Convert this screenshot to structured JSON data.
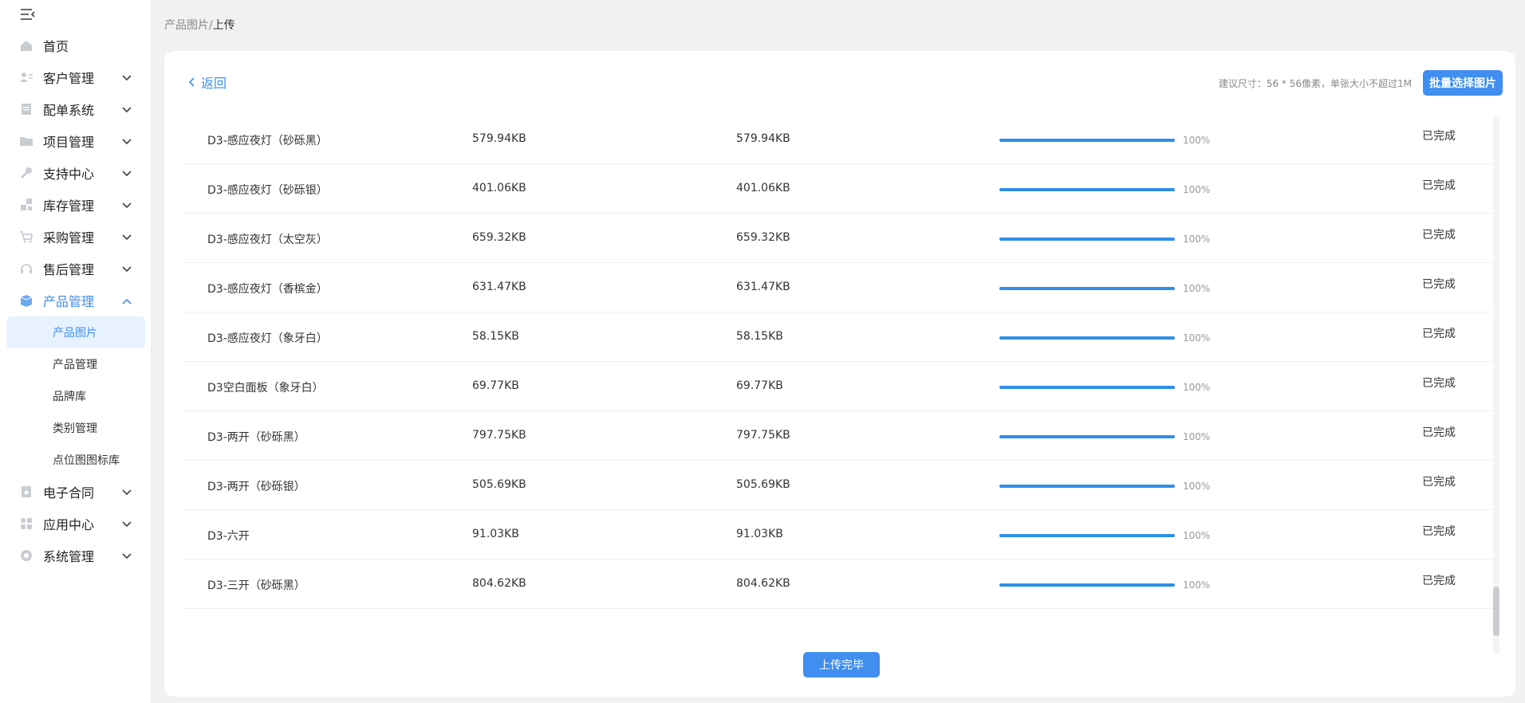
{
  "sidebar": {
    "collapse_icon": "menu-collapse-icon",
    "items": [
      {
        "label": "首页",
        "icon": "home-icon",
        "has_children": false
      },
      {
        "label": "客户管理",
        "icon": "user-card-icon",
        "has_children": true
      },
      {
        "label": "配单系统",
        "icon": "document-icon",
        "has_children": true
      },
      {
        "label": "项目管理",
        "icon": "folder-icon",
        "has_children": true
      },
      {
        "label": "支持中心",
        "icon": "wrench-icon",
        "has_children": true
      },
      {
        "label": "库存管理",
        "icon": "boxes-icon",
        "has_children": true
      },
      {
        "label": "采购管理",
        "icon": "cart-icon",
        "has_children": true
      },
      {
        "label": "售后管理",
        "icon": "headset-icon",
        "has_children": true
      },
      {
        "label": "产品管理",
        "icon": "cube-icon",
        "has_children": true,
        "expanded": true
      }
    ],
    "subitems": [
      {
        "label": "产品图片",
        "selected": true
      },
      {
        "label": "产品管理",
        "selected": false
      },
      {
        "label": "品牌库",
        "selected": false
      },
      {
        "label": "类别管理",
        "selected": false
      },
      {
        "label": "点位图图标库",
        "selected": false
      }
    ],
    "items_after": [
      {
        "label": "电子合同",
        "icon": "contract-icon",
        "has_children": true
      },
      {
        "label": "应用中心",
        "icon": "apps-icon",
        "has_children": true
      },
      {
        "label": "系统管理",
        "icon": "settings-icon",
        "has_children": true
      }
    ]
  },
  "breadcrumb": {
    "parent": "产品图片",
    "separator": "/",
    "current": "上传"
  },
  "toolbar": {
    "back_label": "返回",
    "hint": "建议尺寸：56 * 56像素，单张大小不超过1M",
    "batch_button": "批量选择图片"
  },
  "uploads": [
    {
      "name": "D3-感应夜灯（砂砾黑）",
      "size": "579.94KB",
      "size2": "579.94KB",
      "progress": 100,
      "percent": "100%",
      "status": "已完成"
    },
    {
      "name": "D3-感应夜灯（砂砾银）",
      "size": "401.06KB",
      "size2": "401.06KB",
      "progress": 100,
      "percent": "100%",
      "status": "已完成"
    },
    {
      "name": "D3-感应夜灯（太空灰）",
      "size": "659.32KB",
      "size2": "659.32KB",
      "progress": 100,
      "percent": "100%",
      "status": "已完成"
    },
    {
      "name": "D3-感应夜灯（香槟金）",
      "size": "631.47KB",
      "size2": "631.47KB",
      "progress": 100,
      "percent": "100%",
      "status": "已完成"
    },
    {
      "name": "D3-感应夜灯（象牙白）",
      "size": "58.15KB",
      "size2": "58.15KB",
      "progress": 100,
      "percent": "100%",
      "status": "已完成"
    },
    {
      "name": "D3空白面板（象牙白）",
      "size": "69.77KB",
      "size2": "69.77KB",
      "progress": 100,
      "percent": "100%",
      "status": "已完成"
    },
    {
      "name": "D3-两开（砂砾黑）",
      "size": "797.75KB",
      "size2": "797.75KB",
      "progress": 100,
      "percent": "100%",
      "status": "已完成"
    },
    {
      "name": "D3-两开（砂砾银）",
      "size": "505.69KB",
      "size2": "505.69KB",
      "progress": 100,
      "percent": "100%",
      "status": "已完成"
    },
    {
      "name": "D3-六开",
      "size": "91.03KB",
      "size2": "91.03KB",
      "progress": 100,
      "percent": "100%",
      "status": "已完成"
    },
    {
      "name": "D3-三开（砂砾黑）",
      "size": "804.62KB",
      "size2": "804.62KB",
      "progress": 100,
      "percent": "100%",
      "status": "已完成"
    }
  ],
  "footer": {
    "done_button": "上传完毕"
  },
  "colors": {
    "accent": "#3f8ef0",
    "progress": "#2f8fe8",
    "page_bg": "#f0f1f3"
  }
}
